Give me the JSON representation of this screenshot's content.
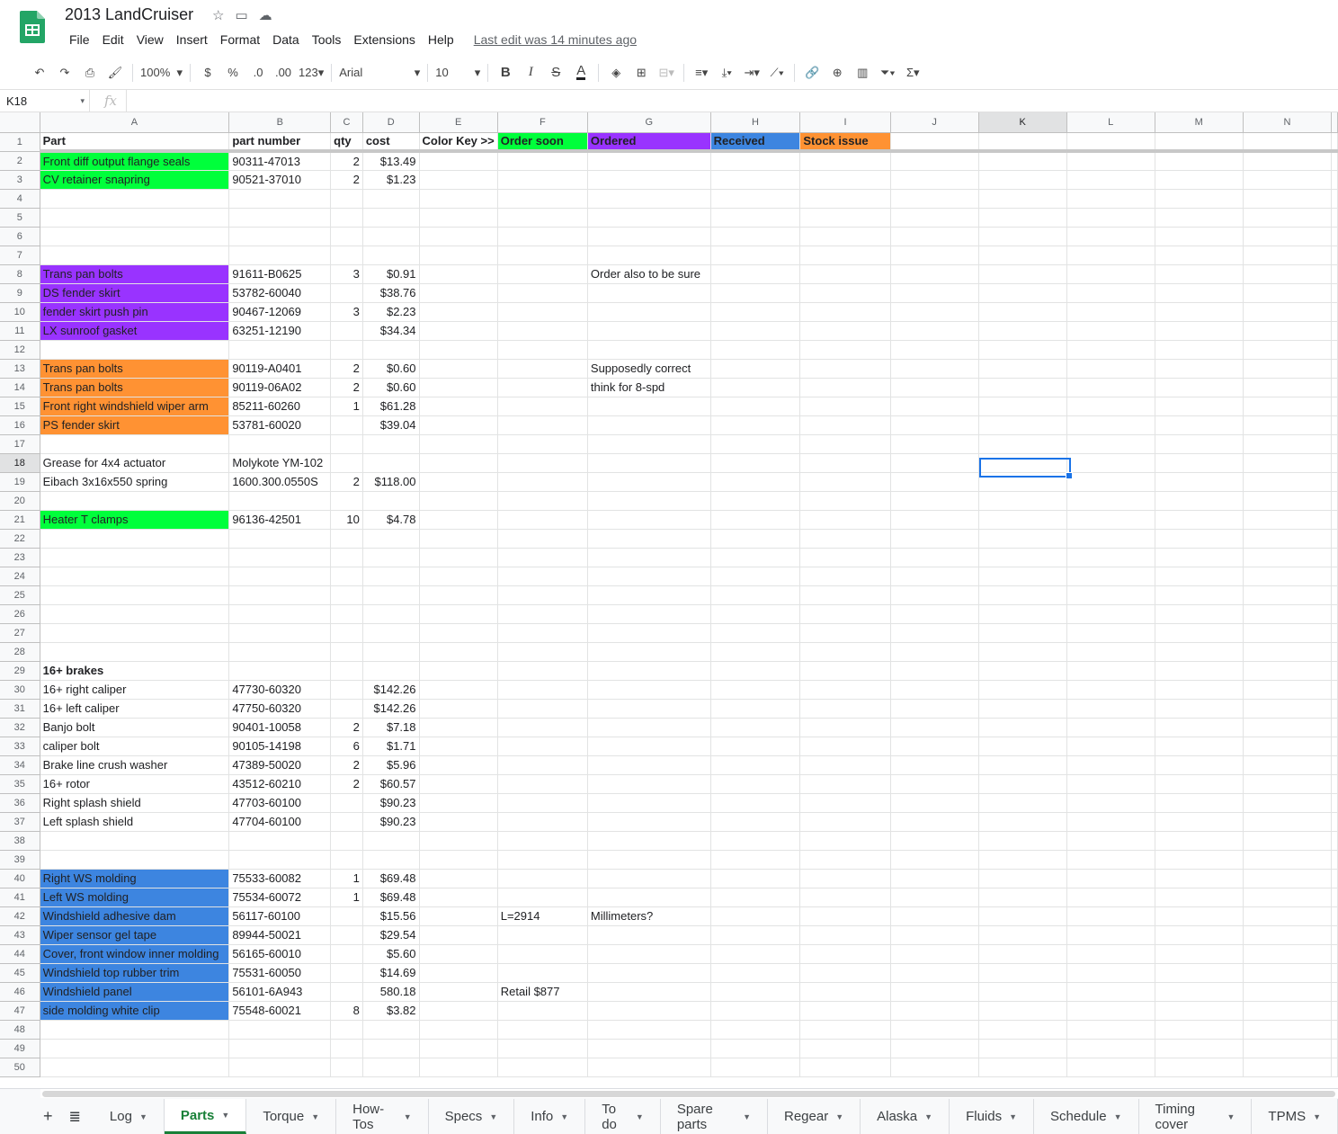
{
  "app": {
    "title": "2013 LandCruiser",
    "last_edit": "Last edit was 14 minutes ago",
    "menu": [
      "File",
      "Edit",
      "View",
      "Insert",
      "Format",
      "Data",
      "Tools",
      "Extensions",
      "Help"
    ]
  },
  "toolbar": {
    "zoom": "100%",
    "currency": "$",
    "percent": "%",
    "dec_decrease": ".0",
    "dec_increase": ".00",
    "number_format": "123",
    "font": "Arial",
    "font_size": "10"
  },
  "formula_bar": {
    "cell_ref": "K18",
    "fx": "fx"
  },
  "columns": [
    "A",
    "B",
    "C",
    "D",
    "E",
    "F",
    "G",
    "H",
    "I",
    "J",
    "K",
    "L",
    "M",
    "N"
  ],
  "colors": {
    "green": "#00ff3b",
    "purple": "#9933ff",
    "blue": "#3d85e0",
    "orange": "#ff9233",
    "accent": "#188038",
    "select": "#1a73e8"
  },
  "rows": [
    {
      "n": "1",
      "A": "Part",
      "B": "part number",
      "C": "qty",
      "D": "cost",
      "E": "Color Key >>",
      "F": "Order soon",
      "G": "Ordered",
      "H": "Received",
      "I": "Stock issue",
      "G_text": "",
      "hdr": true
    },
    {
      "n": "2",
      "A": "Front diff output flange seals",
      "B": "90311-47013",
      "C": "2",
      "D": "$13.49",
      "fill": "green"
    },
    {
      "n": "3",
      "A": "CV retainer snapring",
      "B": "90521-37010",
      "C": "2",
      "D": "$1.23",
      "fill": "green"
    },
    {
      "n": "4"
    },
    {
      "n": "5"
    },
    {
      "n": "6"
    },
    {
      "n": "7"
    },
    {
      "n": "8",
      "A": "Trans pan bolts",
      "B": "91611-B0625",
      "C": "3",
      "D": "$0.91",
      "G": "Order also to be sure",
      "fill": "purple"
    },
    {
      "n": "9",
      "A": "DS fender skirt",
      "B": "53782-60040",
      "D": "$38.76",
      "fill": "purple"
    },
    {
      "n": "10",
      "A": "fender skirt push pin",
      "B": "90467-12069",
      "C": "3",
      "D": "$2.23",
      "fill": "purple"
    },
    {
      "n": "11",
      "A": "LX sunroof gasket",
      "B": "63251-12190",
      "D": "$34.34",
      "fill": "purple"
    },
    {
      "n": "12"
    },
    {
      "n": "13",
      "A": "Trans pan bolts",
      "B": "90119-A0401",
      "C": "2",
      "D": "$0.60",
      "G": "Supposedly correct",
      "fill": "orange"
    },
    {
      "n": "14",
      "A": "Trans pan bolts",
      "B": "90119-06A02",
      "C": "2",
      "D": "$0.60",
      "G": "think for 8-spd",
      "fill": "orange"
    },
    {
      "n": "15",
      "A": "Front right windshield wiper arm",
      "B": "85211-60260",
      "C": "1",
      "D": "$61.28",
      "fill": "orange"
    },
    {
      "n": "16",
      "A": "PS fender skirt",
      "B": "53781-60020",
      "D": "$39.04",
      "fill": "orange"
    },
    {
      "n": "17"
    },
    {
      "n": "18",
      "A": "Grease for 4x4 actuator",
      "B": "Molykote YM-102"
    },
    {
      "n": "19",
      "A": "Eibach 3x16x550 spring",
      "B": "1600.300.0550S",
      "C": "2",
      "D": "$118.00"
    },
    {
      "n": "20"
    },
    {
      "n": "21",
      "A": "Heater T clamps",
      "B": "96136-42501",
      "C": "10",
      "D": "$4.78",
      "fill": "green"
    },
    {
      "n": "22"
    },
    {
      "n": "23"
    },
    {
      "n": "24"
    },
    {
      "n": "25"
    },
    {
      "n": "26"
    },
    {
      "n": "27"
    },
    {
      "n": "28"
    },
    {
      "n": "29",
      "A": "16+ brakes",
      "boldA": true
    },
    {
      "n": "30",
      "A": "16+ right caliper",
      "B": "47730-60320",
      "D": "$142.26"
    },
    {
      "n": "31",
      "A": "16+ left caliper",
      "B": "47750-60320",
      "D": "$142.26"
    },
    {
      "n": "32",
      "A": "Banjo bolt",
      "B": "90401-10058",
      "C": "2",
      "D": "$7.18"
    },
    {
      "n": "33",
      "A": "caliper bolt",
      "B": "90105-14198",
      "C": "6",
      "D": "$1.71"
    },
    {
      "n": "34",
      "A": "Brake line crush washer",
      "B": "47389-50020",
      "C": "2",
      "D": "$5.96"
    },
    {
      "n": "35",
      "A": "16+ rotor",
      "B": "43512-60210",
      "C": "2",
      "D": "$60.57"
    },
    {
      "n": "36",
      "A": "Right splash shield",
      "B": "47703-60100",
      "D": "$90.23"
    },
    {
      "n": "37",
      "A": "Left splash shield",
      "B": "47704-60100",
      "D": "$90.23"
    },
    {
      "n": "38"
    },
    {
      "n": "39"
    },
    {
      "n": "40",
      "A": "Right WS molding",
      "B": "75533-60082",
      "C": "1",
      "D": "$69.48",
      "fill": "blue"
    },
    {
      "n": "41",
      "A": "Left WS molding",
      "B": "75534-60072",
      "C": "1",
      "D": "$69.48",
      "fill": "blue"
    },
    {
      "n": "42",
      "A": "Windshield adhesive dam",
      "B": "56117-60100",
      "D": "$15.56",
      "F": "L=2914",
      "G": "Millimeters?",
      "fill": "blue"
    },
    {
      "n": "43",
      "A": "Wiper sensor gel tape",
      "B": "89944-50021",
      "D": "$29.54",
      "fill": "blue"
    },
    {
      "n": "44",
      "A": "Cover, front window inner molding",
      "B": "56165-60010",
      "D": "$5.60",
      "fill": "blue"
    },
    {
      "n": "45",
      "A": "Windshield top rubber trim",
      "B": "75531-60050",
      "D": "$14.69",
      "fill": "blue"
    },
    {
      "n": "46",
      "A": "Windshield panel",
      "B": "56101-6A943",
      "D": "580.18",
      "F": "Retail $877",
      "fill": "blue"
    },
    {
      "n": "47",
      "A": "side molding white clip",
      "B": "75548-60021",
      "C": "8",
      "D": "$3.82",
      "fill": "blue"
    },
    {
      "n": "48"
    },
    {
      "n": "49"
    },
    {
      "n": "50"
    }
  ],
  "tabs": [
    "Log",
    "Parts",
    "Torque",
    "How-Tos",
    "Specs",
    "Info",
    "To do",
    "Spare parts",
    "Regear",
    "Alaska",
    "Fluids",
    "Schedule",
    "Timing cover",
    "TPMS"
  ],
  "active_tab": "Parts"
}
